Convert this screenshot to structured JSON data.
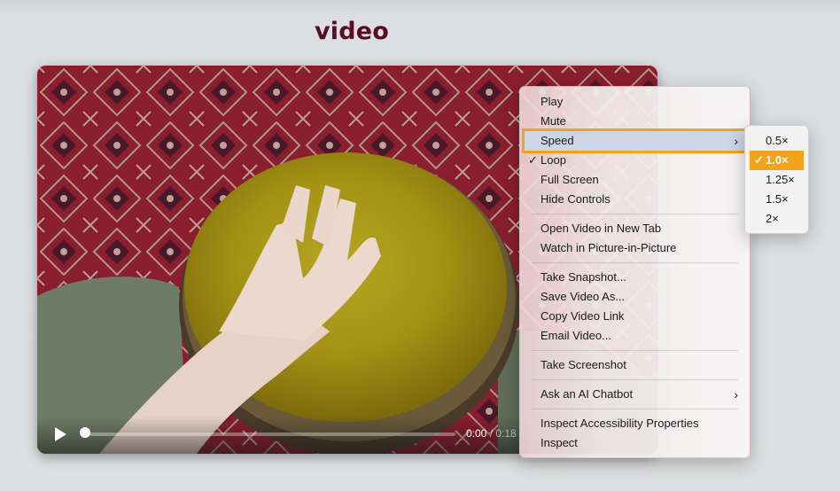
{
  "page": {
    "heading": "video"
  },
  "player": {
    "current_time": "0:00",
    "duration": "/ 0:18",
    "progress": 0
  },
  "context_menu": {
    "play": "Play",
    "mute": "Mute",
    "speed": "Speed",
    "loop": "Loop",
    "loop_checked": "✓",
    "full_screen": "Full Screen",
    "hide_controls": "Hide Controls",
    "open_new_tab": "Open Video in New Tab",
    "pip": "Watch in Picture-in-Picture",
    "take_snapshot": "Take Snapshot...",
    "save_video": "Save Video As...",
    "copy_link": "Copy Video Link",
    "email_video": "Email Video...",
    "take_screenshot": "Take Screenshot",
    "ask_ai": "Ask an AI Chatbot",
    "inspect_a11y": "Inspect Accessibility Properties",
    "inspect": "Inspect",
    "submenu_chevron": "›"
  },
  "speed_menu": {
    "options": [
      "0.5×",
      "1.0×",
      "1.25×",
      "1.5×",
      "2×"
    ],
    "selected": "1.0×",
    "check": "✓"
  },
  "colors": {
    "heading": "#5a0c22",
    "highlight_outline": "#f2a31b",
    "selected_bg": "#f2a31b"
  }
}
